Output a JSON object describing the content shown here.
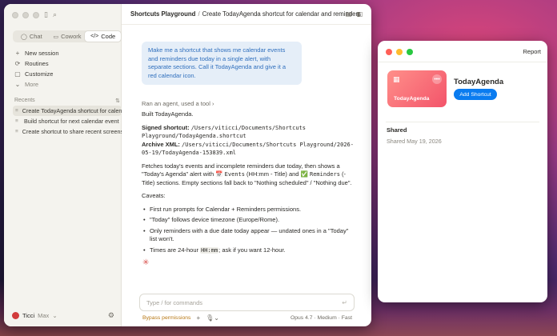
{
  "sidebar": {
    "modes": [
      {
        "label": "Chat",
        "icon": "chat-bubble-icon"
      },
      {
        "label": "Cowork",
        "icon": "cowork-icon"
      },
      {
        "label": "Code",
        "icon": "code-icon"
      }
    ],
    "nav": [
      {
        "label": "New session",
        "icon": "plus-icon"
      },
      {
        "label": "Routines",
        "icon": "routines-icon"
      },
      {
        "label": "Customize",
        "icon": "customize-icon"
      },
      {
        "label": "More",
        "icon": "chevron-down-icon"
      }
    ],
    "recents_label": "Recents",
    "recents": [
      "Create TodayAgenda shortcut for calendar and reminders",
      "Build shortcut for next calendar event",
      "Create shortcut to share recent screenshot"
    ],
    "user_name": "Ticci",
    "user_plan": "Max"
  },
  "header": {
    "breadcrumb_project": "Shortcuts Playground",
    "breadcrumb_sep": "/",
    "breadcrumb_session": "Create TodayAgenda shortcut for calendar and reminders"
  },
  "chat": {
    "user_message": "Make me a shortcut that shows me calendar events and reminders due today in a single alert, with separate sections. Call it TodayAgenda and give it a red calendar icon.",
    "tool_line": "Ran an agent, used a tool",
    "built": "Built TodayAgenda.",
    "signed_label": "Signed shortcut:",
    "signed_path": "/Users/viticci/Documents/Shortcuts Playground/TodayAgenda.shortcut",
    "archive_label": "Archive XML:",
    "archive_path": "/Users/viticci/Documents/Shortcuts Playground/2026-05-19/TodayAgenda-153839.xml",
    "desc_1": "Fetches today's events and incomplete reminders due today, then shows a \"Today's Agenda\" alert with ",
    "events_emoji": "📅",
    "events_word": "Events",
    "desc_2": " (HH:mm - Title) and ",
    "reminders_emoji": "✅",
    "reminders_word": "Reminders",
    "desc_3": " (- Title) sections. Empty sections fall back to \"Nothing scheduled\" / \"Nothing due\".",
    "caveats_label": "Caveats:",
    "caveats": [
      "First run prompts for Calendar + Reminders permissions.",
      "\"Today\" follows device timezone (Europe/Rome).",
      "Only reminders with a due date today appear — undated ones in a \"Today\" list won't."
    ],
    "caveat_time_a": "Times are 24-hour ",
    "caveat_time_code": "HH:mm",
    "caveat_time_b": "; ask if you want 12-hour.",
    "composer_placeholder": "Type / for commands",
    "bypass_label": "Bypass permissions",
    "model_info": "Opus 4.7 · Medium · Fast"
  },
  "shortcut_window": {
    "report_label": "Report",
    "tile_name": "TodayAgenda",
    "name": "TodayAgenda",
    "add_button": "Add Shortcut",
    "shared_heading": "Shared",
    "shared_date": "Shared May 19, 2026",
    "tile_color": "#f3546a"
  },
  "colors": {
    "accent_blue": "#0a7cf0",
    "user_bubble_text": "#2f6fbd",
    "bypass": "#b77712"
  }
}
